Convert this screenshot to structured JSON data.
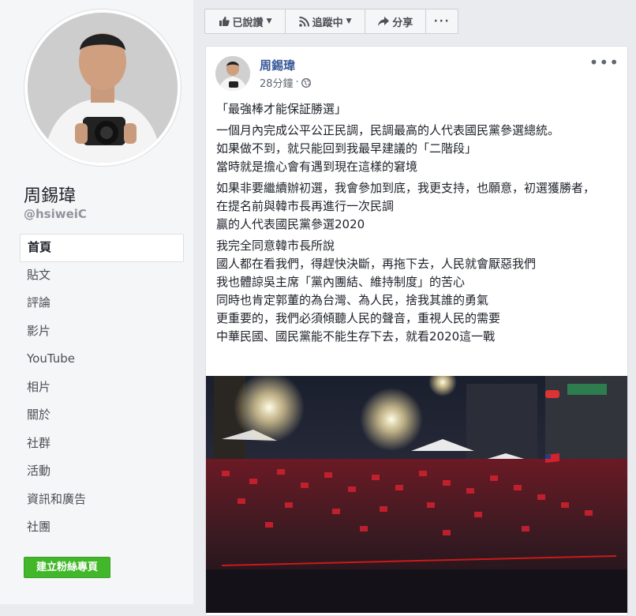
{
  "sidebar": {
    "page_name": "周錫瑋",
    "username": "@hsiweiC",
    "nav": [
      {
        "label": "首頁",
        "active": true
      },
      {
        "label": "貼文",
        "active": false
      },
      {
        "label": "評論",
        "active": false
      },
      {
        "label": "影片",
        "active": false
      },
      {
        "label": "YouTube",
        "active": false
      },
      {
        "label": "相片",
        "active": false
      },
      {
        "label": "關於",
        "active": false
      },
      {
        "label": "社群",
        "active": false
      },
      {
        "label": "活動",
        "active": false
      },
      {
        "label": "資訊和廣告",
        "active": false
      },
      {
        "label": "社團",
        "active": false
      }
    ],
    "create_page_label": "建立粉絲專頁"
  },
  "actionbar": {
    "liked_label": "已說讚",
    "following_label": "追蹤中",
    "share_label": "分享",
    "more_label": "···"
  },
  "post": {
    "author": "周錫瑋",
    "time": "28分鐘",
    "separator": "·",
    "audience_icon": "globe-icon",
    "more_label": "•••",
    "paragraphs": [
      [
        "「最強棒才能保証勝選」"
      ],
      [
        "一個月內完成公平公正民調，民調最高的人代表國民黨參選總統。",
        "如果做不到，就只能回到我最早建議的「二階段」",
        "當時就是擔心會有遇到現在這樣的窘境"
      ],
      [
        "如果非要繼續辦初選，我會參加到底，我更支持，也願意，初選獲勝者，",
        "在提名前與韓市長再進行一次民調",
        "贏的人代表國民黨參選2020"
      ],
      [
        "我完全同意韓市長所說",
        "國人都在看我們，得趕快決斷，再拖下去，人民就會厭惡我們",
        "我也體諒吳主席「黨內團結、維持制度」的苦心",
        "同時也肯定郭董的為台灣、為人民，捨我其誰的勇氣",
        "更重要的，我們必須傾聽人民的聲音，重視人民的需要",
        "中華民國、國民黨能不能生存下去，就看2020這一戰"
      ]
    ]
  },
  "colors": {
    "link": "#385898",
    "create_button": "#42b72a",
    "background": "#e9ebee"
  }
}
